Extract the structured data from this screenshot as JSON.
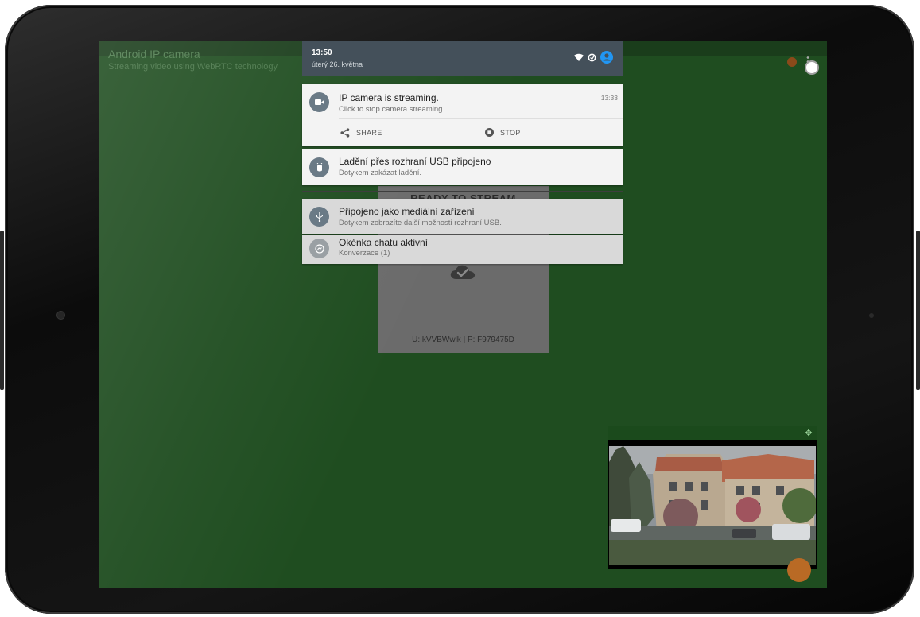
{
  "app": {
    "title": "Android IP camera",
    "subtitle": "Streaming video using WebRTC technology"
  },
  "stream_card": {
    "title": "READY TO STREAM",
    "credentials": "U: kVVBWwlk | P: F979475D"
  },
  "status_bar": {
    "time": "13:50",
    "date": "úterý 26. května"
  },
  "notifications": [
    {
      "title": "IP camera is streaming.",
      "text": "Click to stop camera streaming.",
      "time": "13:33",
      "actions": [
        "SHARE",
        "STOP"
      ]
    },
    {
      "title": "Ladění přes rozhraní USB připojeno",
      "text": "Dotykem zakázat ladění."
    },
    {
      "title": "Připojeno jako mediální zařízení",
      "text": "Dotykem zobrazíte další možnosti rozhraní USB."
    },
    {
      "title": "Okénka chatu aktivní",
      "text": "Konverzace (1)"
    }
  ],
  "colors": {
    "screen_bg": "#1f4d20",
    "shade_header": "#44505a",
    "notification_bg": "#f3f3f3",
    "accent_orange": "#b96a25",
    "status_accent": "#2196f3"
  },
  "icons": {
    "wifi": "wifi-icon",
    "data_saver": "data-saver-icon",
    "account": "account-icon",
    "camera": "videocam-icon",
    "android_debug": "android-bug-icon",
    "usb": "usb-icon",
    "messenger": "messenger-icon",
    "share": "share-icon",
    "stop": "stop-icon",
    "cloud": "cloud-done-icon",
    "move": "move-icon"
  }
}
